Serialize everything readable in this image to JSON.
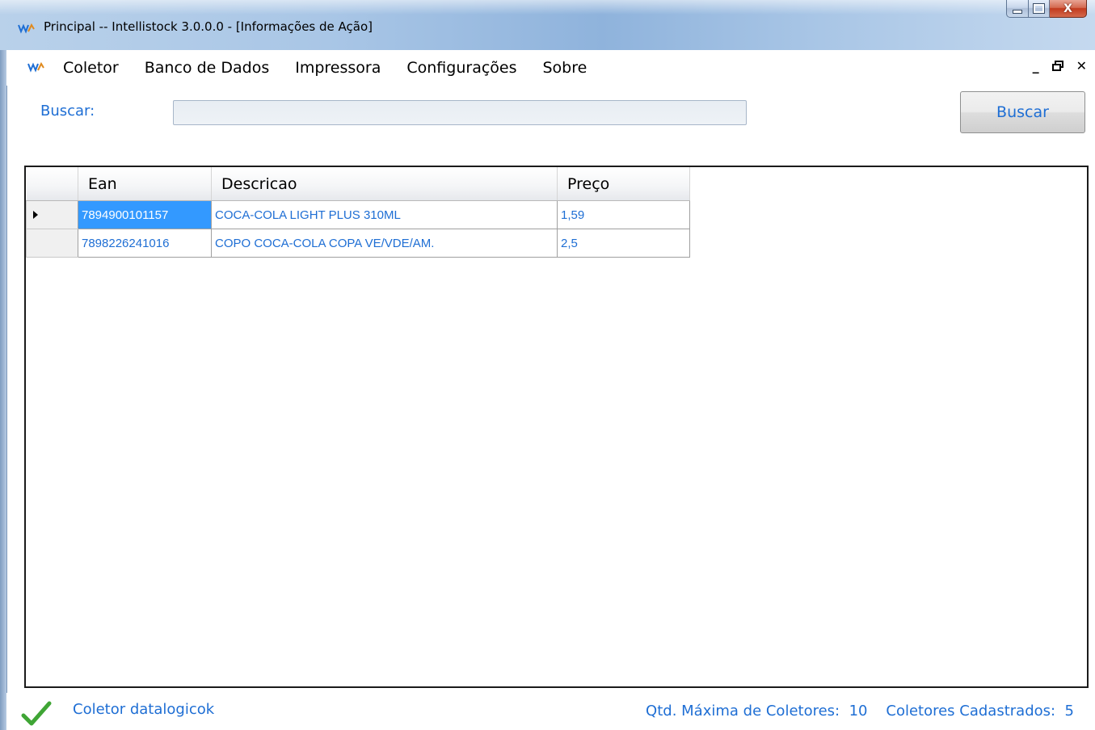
{
  "window": {
    "title": "Principal -- Intellistock 3.0.0.0 - [Informações de Ação]",
    "controls": {
      "minimize": "_",
      "maximize": "□",
      "close": "X"
    }
  },
  "menu": {
    "items": [
      "Coletor",
      "Banco de Dados",
      "Impressora",
      "Configurações",
      "Sobre"
    ],
    "mdi": {
      "minimize": "_",
      "restore": "🗗",
      "close": "✕"
    }
  },
  "search": {
    "label": "Buscar:",
    "value": "",
    "button_label": "Buscar"
  },
  "grid": {
    "columns": [
      "Ean",
      "Descricao",
      "Preço"
    ],
    "rows": [
      {
        "ean": "7894900101157",
        "descricao": "COCA-COLA LIGHT PLUS 310ML",
        "preco": "1,59",
        "current": true
      },
      {
        "ean": "7898226241016",
        "descricao": "COPO COCA-COLA COPA VE/VDE/AM.",
        "preco": "2,5",
        "current": false
      }
    ]
  },
  "status": {
    "left_text": "Coletor datalogicok",
    "max_label": "Qtd. Máxima de Coletores:",
    "max_value": "10",
    "registered_label": "Coletores Cadastrados:",
    "registered_value": "5"
  },
  "colors": {
    "accent_text": "#1e6ed4",
    "selection": "#3399ff",
    "check": "#3fa535"
  },
  "icons": {
    "app": "app-logo-icon",
    "status": "check-icon",
    "current_row": "row-arrow-icon"
  }
}
